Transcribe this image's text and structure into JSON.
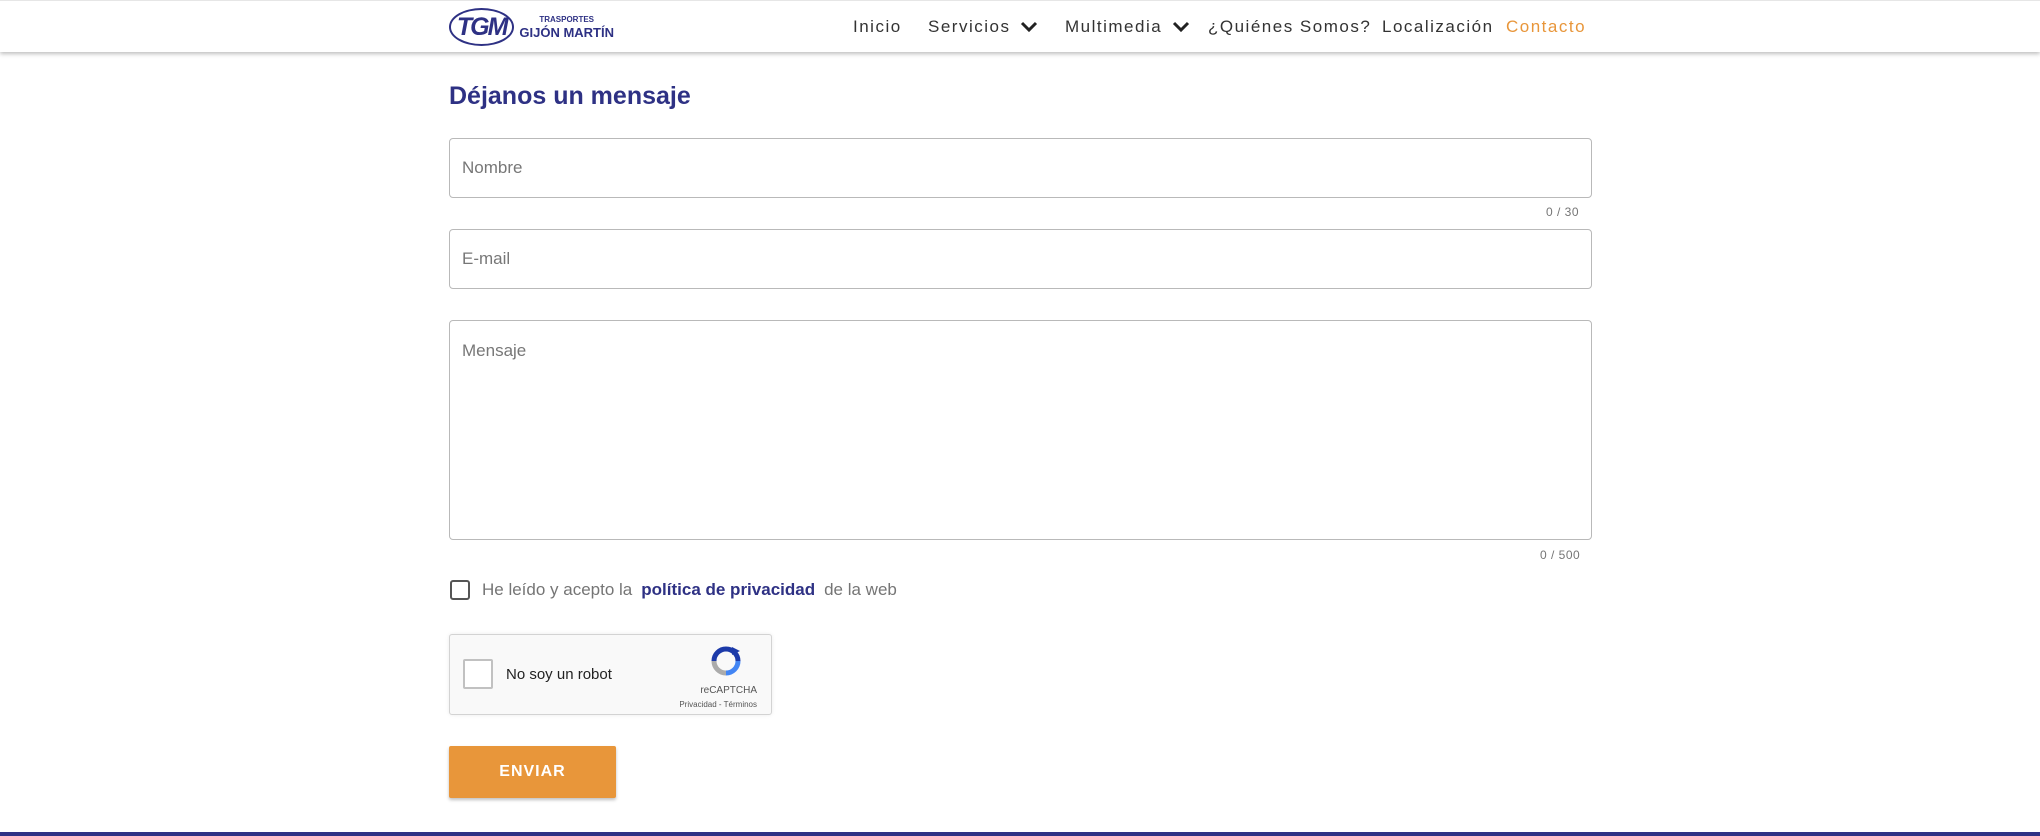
{
  "header": {
    "logo": {
      "small_text": "TRASPORTES",
      "big_text": "GIJÓN MARTÍN",
      "mark_text": "TGM",
      "color": "#2e3184"
    },
    "nav": [
      {
        "label": "Inicio"
      },
      {
        "label": "Servicios",
        "icon": "chevron-down-icon"
      },
      {
        "label": "Multimedia",
        "icon": "chevron-down-icon"
      },
      {
        "label": "¿Quiénes Somos?"
      },
      {
        "label": "Localización"
      },
      {
        "label": "Contacto",
        "active": true
      }
    ],
    "active_color": "#e8963a"
  },
  "form": {
    "heading": "Déjanos un mensaje",
    "name": {
      "placeholder": "Nombre",
      "value": "",
      "counter": "0 / 30"
    },
    "email": {
      "placeholder": "E-mail",
      "value": ""
    },
    "message": {
      "placeholder": "Mensaje",
      "value": "",
      "counter": "0 / 500"
    },
    "consent": {
      "before": "He leído y acepto la",
      "link": "política de privacidad",
      "after": "de la web",
      "checked": false
    },
    "recaptcha": {
      "label": "No soy un robot",
      "brand": "reCAPTCHA",
      "terms": "Privacidad - Términos"
    },
    "submit_label": "ENVIAR",
    "submit_color": "#e8963a"
  }
}
